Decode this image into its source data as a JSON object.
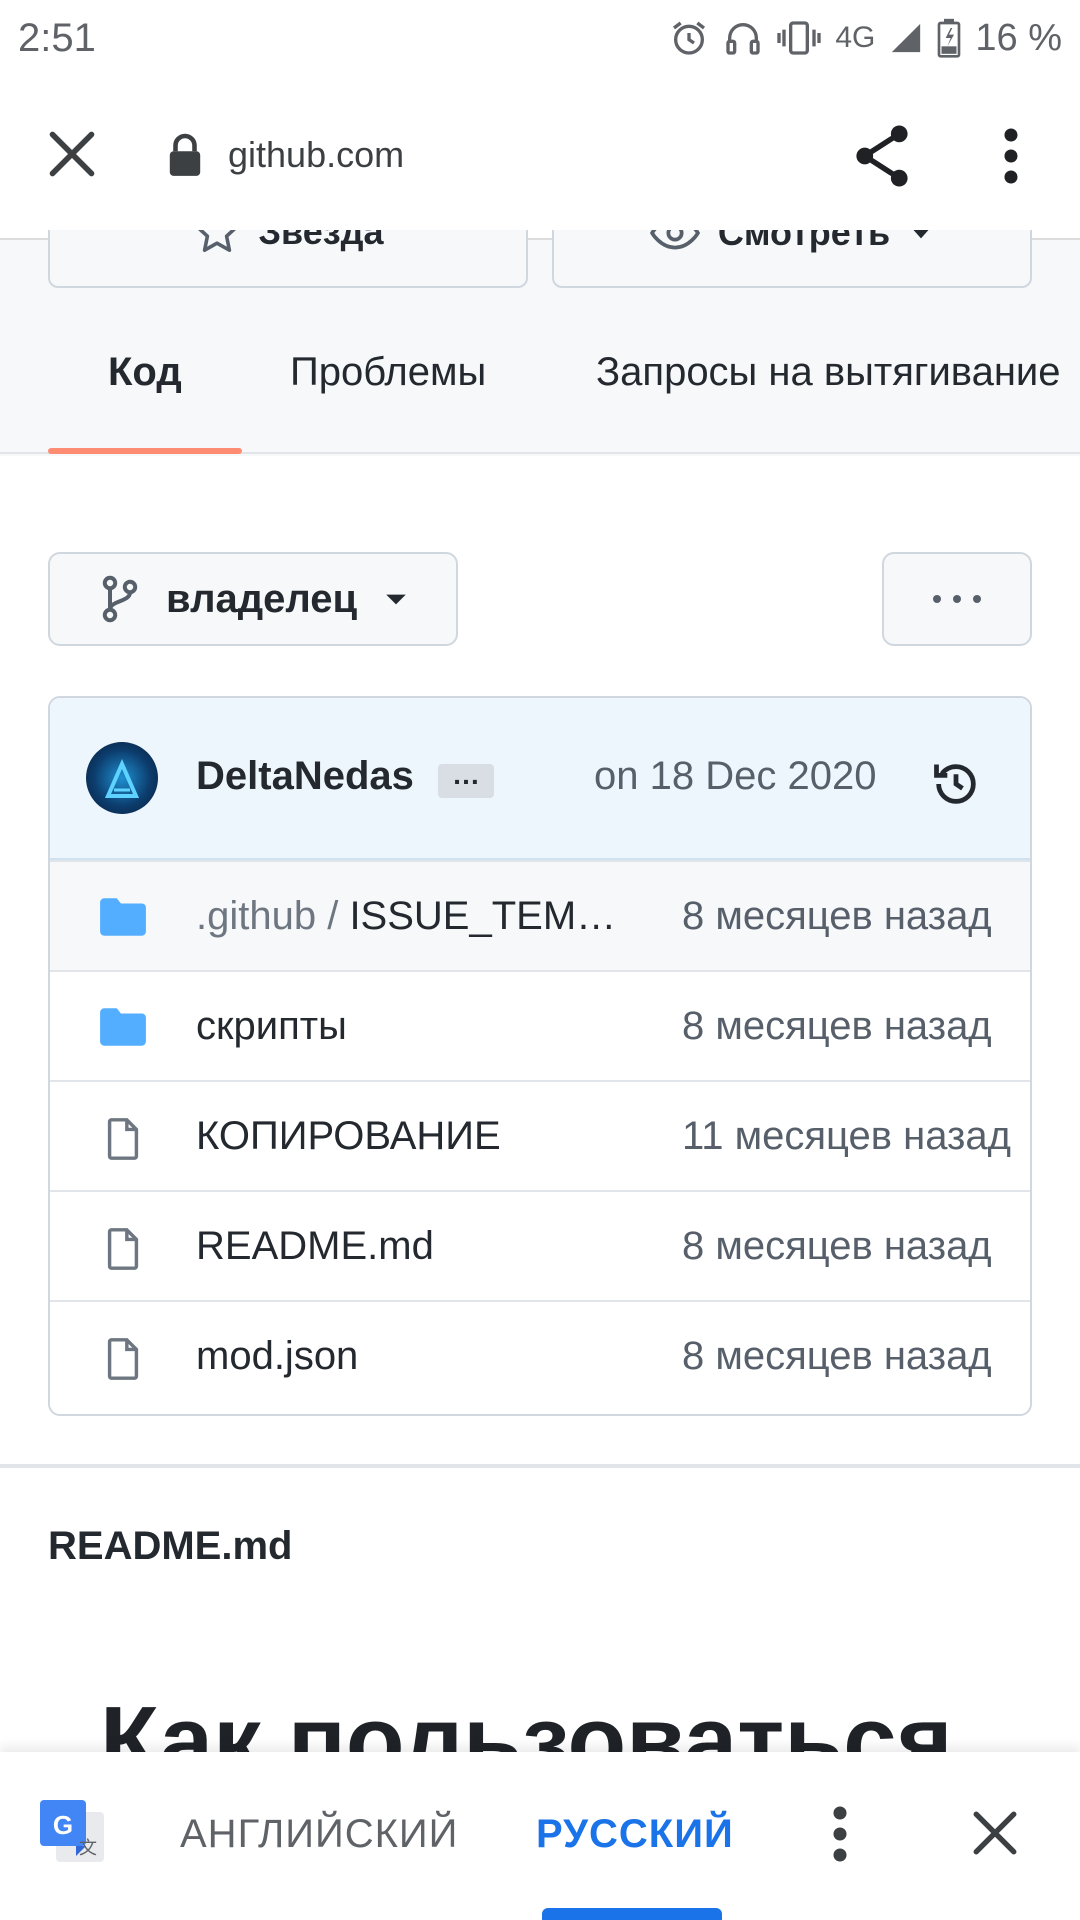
{
  "status_bar": {
    "time": "2:51",
    "network": "4G",
    "battery": "16 %"
  },
  "url_bar": {
    "host": "github.com"
  },
  "repo_actions": {
    "star_label": "Звезда",
    "watch_label": "Смотреть"
  },
  "tabs": [
    {
      "label": "Код",
      "active": true
    },
    {
      "label": "Проблемы",
      "active": false
    },
    {
      "label": "Запросы на вытягивание",
      "active": false
    }
  ],
  "branch": {
    "name": "владелец"
  },
  "commit": {
    "author": "DeltaNedas",
    "ellipsis": "…",
    "date": "on 18 Dec 2020"
  },
  "files": [
    {
      "type": "folder",
      "prefix": ".github / ",
      "name": "ISSUE_TEM…",
      "age": "8 месяцев назад"
    },
    {
      "type": "folder",
      "prefix": "",
      "name": "скрипты",
      "age": "8 месяцев назад"
    },
    {
      "type": "file",
      "prefix": "",
      "name": "КОПИРОВАНИЕ",
      "age": "11 месяцев назад"
    },
    {
      "type": "file",
      "prefix": "",
      "name": "README.md",
      "age": "8 месяцев назад"
    },
    {
      "type": "file",
      "prefix": "",
      "name": "mod.json",
      "age": "8 месяцев назад"
    }
  ],
  "readme": {
    "title": "README.md",
    "heading": "Как пользоваться"
  },
  "translate_bar": {
    "source_lang": "АНГЛИЙСКИЙ",
    "target_lang": "РУССКИЙ"
  },
  "colors": {
    "accent_tab": "#fd8c73",
    "link_blue": "#1a73e8",
    "folder_blue": "#54aeff"
  }
}
